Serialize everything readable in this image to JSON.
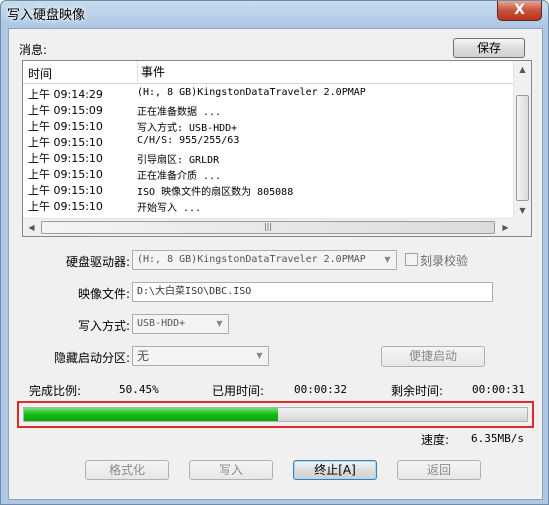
{
  "window": {
    "title": "写入硬盘映像",
    "close_label": "X"
  },
  "messages": {
    "label": "消息:",
    "save_button": "保存",
    "columns": [
      "时间",
      "事件"
    ],
    "rows": [
      {
        "time": "上午 09:14:29",
        "event": "(H:, 8 GB)KingstonDataTraveler 2.0PMAP"
      },
      {
        "time": "上午 09:15:09",
        "event": "正在准备数据 ..."
      },
      {
        "time": "上午 09:15:10",
        "event": "写入方式: USB-HDD+"
      },
      {
        "time": "上午 09:15:10",
        "event": "C/H/S: 955/255/63"
      },
      {
        "time": "上午 09:15:10",
        "event": "引导扇区: GRLDR"
      },
      {
        "time": "上午 09:15:10",
        "event": "正在准备介质 ..."
      },
      {
        "time": "上午 09:15:10",
        "event": "ISO 映像文件的扇区数为 805088"
      },
      {
        "time": "上午 09:15:10",
        "event": "开始写入 ..."
      }
    ]
  },
  "form": {
    "drive_label": "硬盘驱动器:",
    "drive_value": "(H:, 8 GB)KingstonDataTraveler 2.0PMAP",
    "verify_label": "刻录校验",
    "image_label": "映像文件:",
    "image_value": "D:\\大白菜ISO\\DBC.ISO",
    "write_mode_label": "写入方式:",
    "write_mode_value": "USB-HDD+",
    "hidden_part_label": "隐藏启动分区:",
    "hidden_part_value": "无",
    "quick_boot_button": "便捷启动"
  },
  "progress": {
    "ratio_label": "完成比例:",
    "ratio_value": "50.45%",
    "fraction": 0.5045,
    "elapsed_label": "已用时间:",
    "elapsed_value": "00:00:32",
    "remaining_label": "剩余时间:",
    "remaining_value": "00:00:31",
    "speed_label": "速度:",
    "speed_value": "6.35MB/s"
  },
  "buttons": {
    "format": "格式化",
    "write": "写入",
    "stop": "终止[A]",
    "back": "返回"
  }
}
